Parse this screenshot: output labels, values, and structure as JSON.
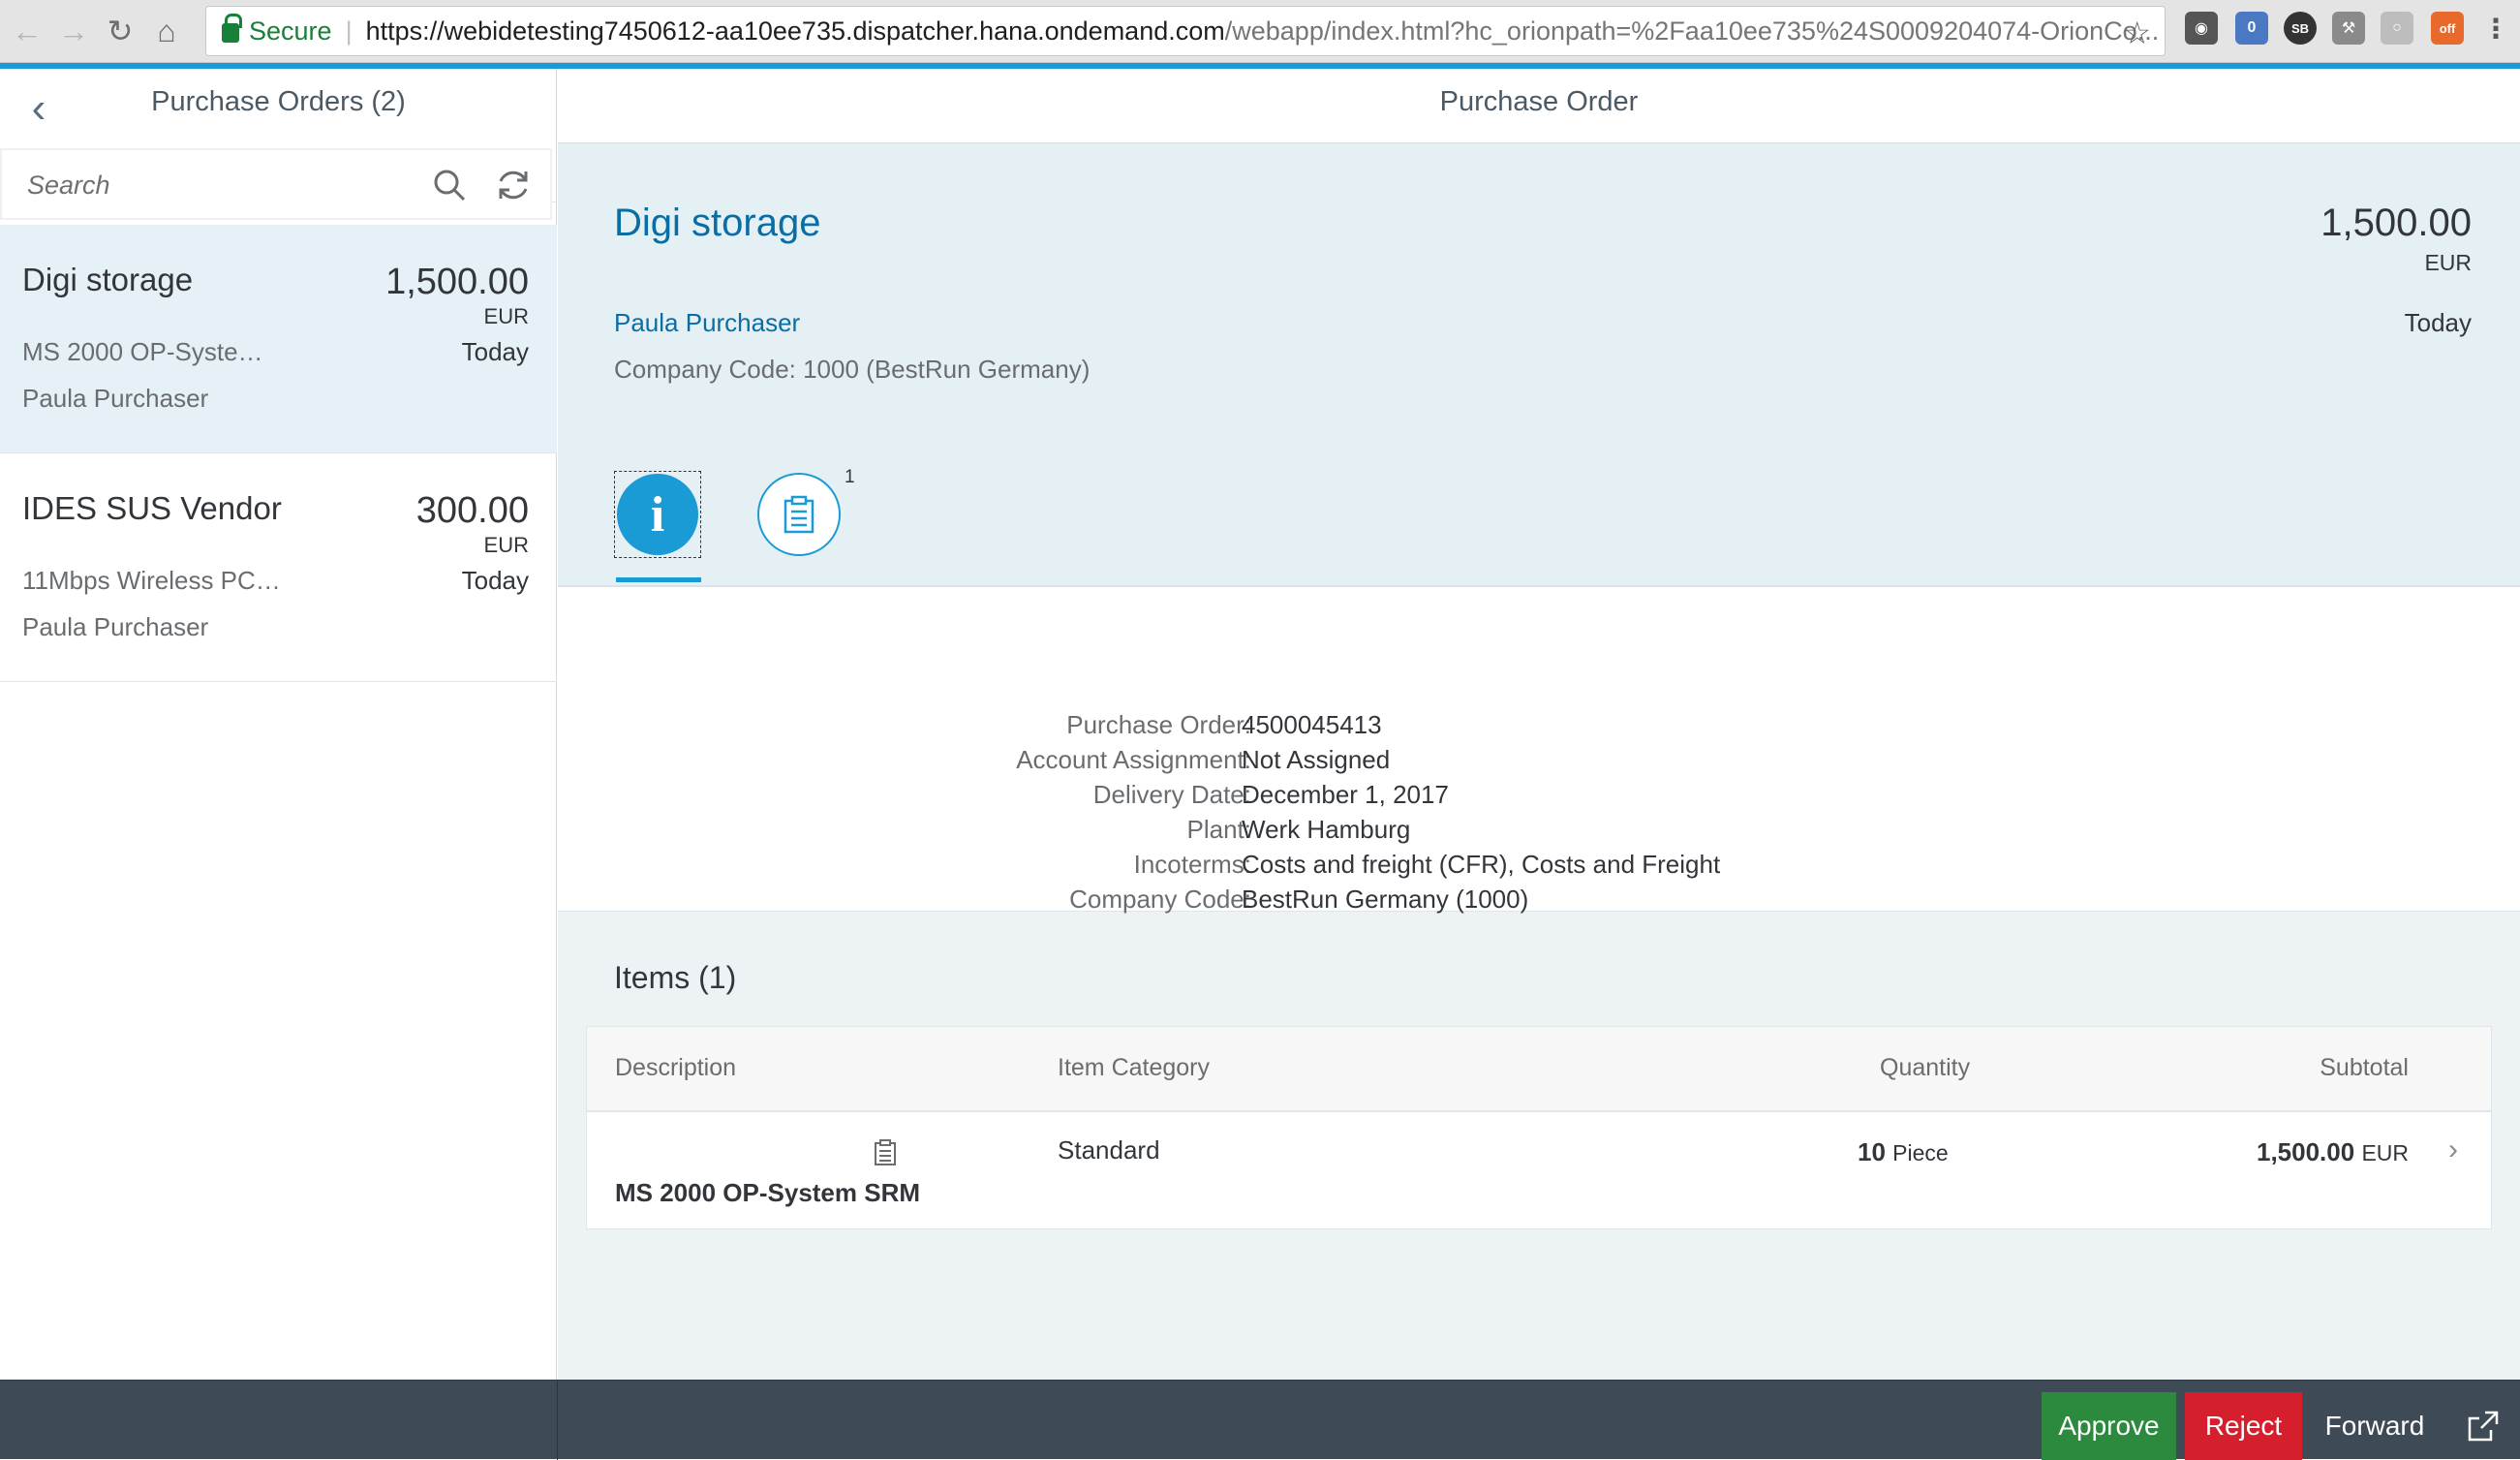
{
  "browser": {
    "secure_label": "Secure",
    "url_host": "https://webidetesting7450612-aa10ee735.dispatcher.hana.ondemand.com",
    "url_path": "/webapp/index.html?hc_orionpath=%2Faa10ee735%24S0009204074-OrionCo...",
    "ext_badge": "0",
    "ext_sb": "SB",
    "ext_off": "off"
  },
  "master": {
    "title": "Purchase Orders (2)",
    "search_placeholder": "Search",
    "items": [
      {
        "name": "Digi storage",
        "amount": "1,500.00",
        "currency": "EUR",
        "desc": "MS 2000 OP-Syste…",
        "date": "Today",
        "buyer": "Paula Purchaser"
      },
      {
        "name": "IDES SUS Vendor",
        "amount": "300.00",
        "currency": "EUR",
        "desc": "11Mbps Wireless PC…",
        "date": "Today",
        "buyer": "Paula Purchaser"
      }
    ]
  },
  "detail": {
    "title": "Purchase Order",
    "header": {
      "name": "Digi storage",
      "amount": "1,500.00",
      "currency": "EUR",
      "buyer": "Paula Purchaser",
      "date": "Today",
      "company": "Company Code: 1000 (BestRun Germany)"
    },
    "tabs": {
      "notes_count": "1"
    },
    "info": [
      {
        "label": "Purchase Order:",
        "value": "4500045413"
      },
      {
        "label": "Account Assignment:",
        "value": "Not Assigned"
      },
      {
        "label": "Delivery Date:",
        "value": "December 1, 2017"
      },
      {
        "label": "Plant:",
        "value": "Werk Hamburg"
      },
      {
        "label": "Incoterms:",
        "value": "Costs and freight (CFR), Costs and Freight"
      },
      {
        "label": "Company Code:",
        "value": "BestRun Germany (1000)"
      }
    ],
    "items": {
      "title": "Items (1)",
      "columns": [
        "Description",
        "Item Category",
        "Quantity",
        "Subtotal"
      ],
      "rows": [
        {
          "description": "MS 2000 OP-System SRM",
          "category": "Standard",
          "quantity": "10",
          "unit": "Piece",
          "subtotal": "1,500.00",
          "currency": "EUR"
        }
      ]
    }
  },
  "footer": {
    "approve": "Approve",
    "reject": "Reject",
    "forward": "Forward"
  },
  "colors": {
    "accent": "#1b9bd6",
    "approve": "#2b8a3e",
    "reject": "#d61f2c",
    "footer": "#3e4a55"
  }
}
